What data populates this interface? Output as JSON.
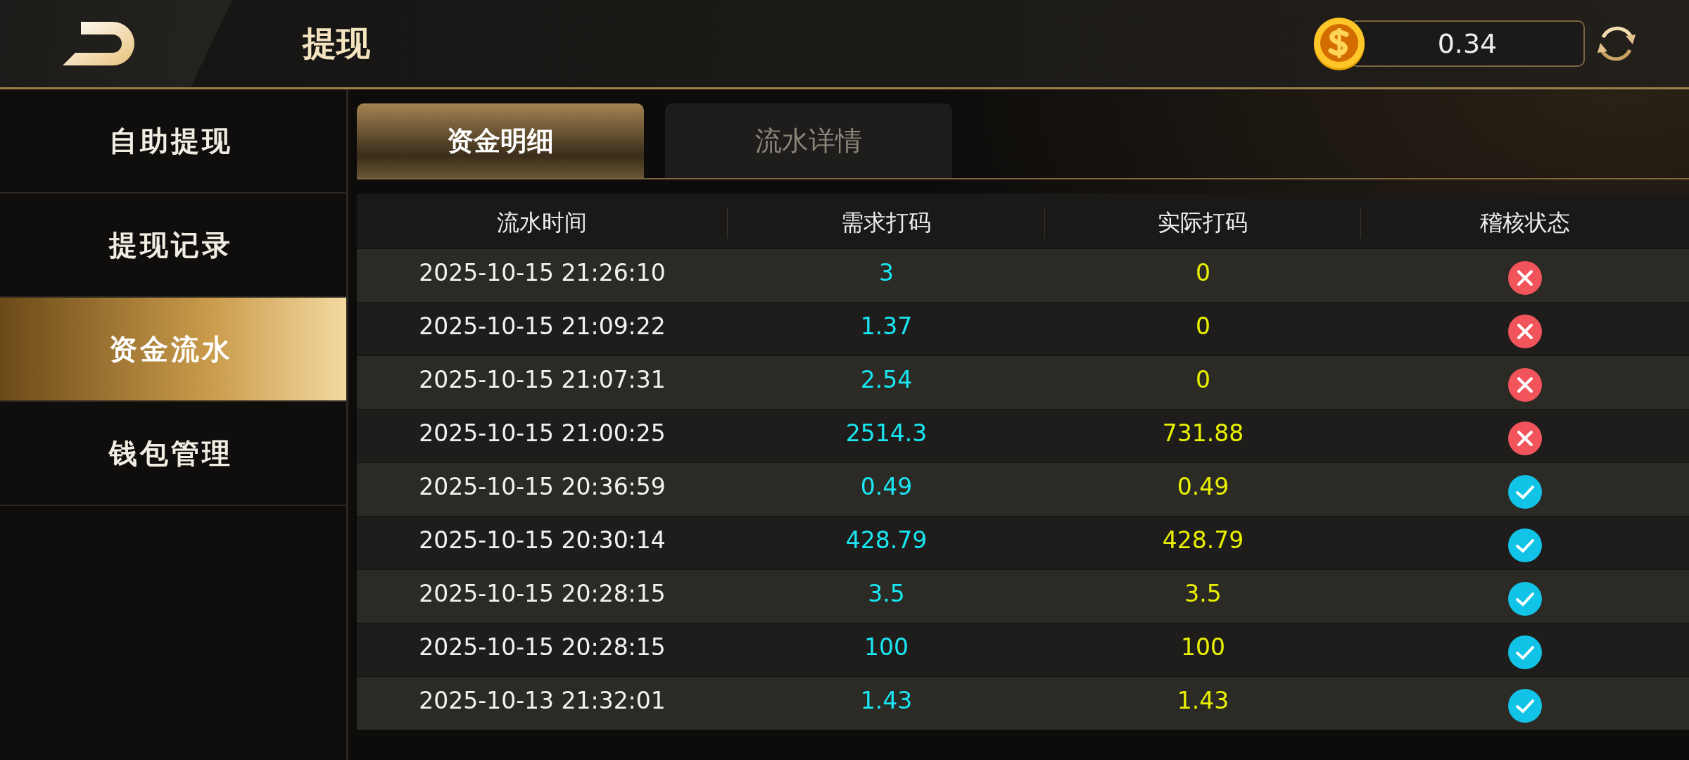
{
  "header": {
    "title": "提现",
    "balance": "0.34"
  },
  "sidebar": {
    "items": [
      {
        "label": "自助提现",
        "selected": false
      },
      {
        "label": "提现记录",
        "selected": false
      },
      {
        "label": "资金流水",
        "selected": true
      },
      {
        "label": "钱包管理",
        "selected": false
      }
    ]
  },
  "tabs": [
    {
      "label": "资金明细",
      "selected": true
    },
    {
      "label": "流水详情",
      "selected": false
    }
  ],
  "table": {
    "columns": [
      "流水时间",
      "需求打码",
      "实际打码",
      "稽核状态"
    ],
    "rows": [
      {
        "time": "2025-10-15 21:26:10",
        "required": "3",
        "actual": "0",
        "passed": false
      },
      {
        "time": "2025-10-15 21:09:22",
        "required": "1.37",
        "actual": "0",
        "passed": false
      },
      {
        "time": "2025-10-15 21:07:31",
        "required": "2.54",
        "actual": "0",
        "passed": false
      },
      {
        "time": "2025-10-15 21:00:25",
        "required": "2514.3",
        "actual": "731.88",
        "passed": false
      },
      {
        "time": "2025-10-15 20:36:59",
        "required": "0.49",
        "actual": "0.49",
        "passed": true
      },
      {
        "time": "2025-10-15 20:30:14",
        "required": "428.79",
        "actual": "428.79",
        "passed": true
      },
      {
        "time": "2025-10-15 20:28:15",
        "required": "3.5",
        "actual": "3.5",
        "passed": true
      },
      {
        "time": "2025-10-15 20:28:15",
        "required": "100",
        "actual": "100",
        "passed": true
      },
      {
        "time": "2025-10-13 21:32:01",
        "required": "1.43",
        "actual": "1.43",
        "passed": true
      }
    ]
  }
}
